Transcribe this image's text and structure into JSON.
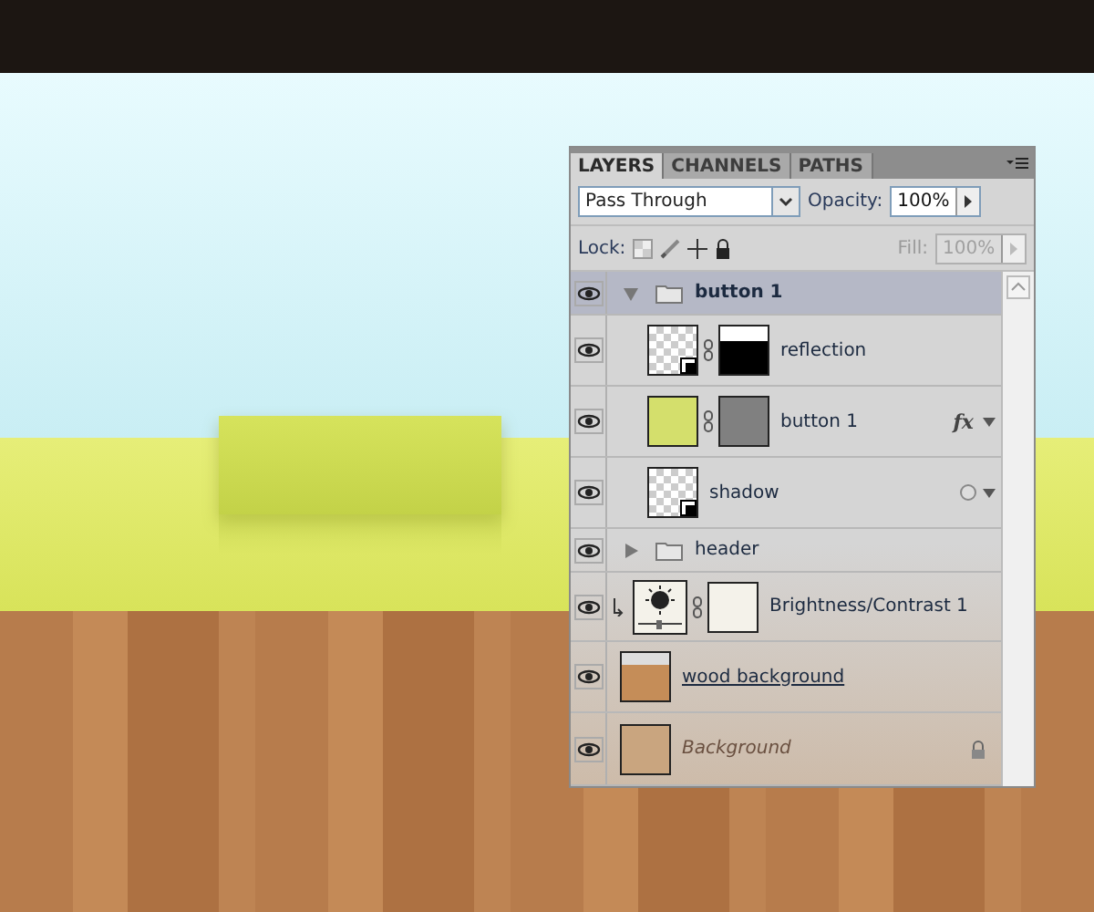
{
  "panel": {
    "tabs": [
      {
        "label": "LAYERS",
        "selected": true
      },
      {
        "label": "CHANNELS",
        "selected": false
      },
      {
        "label": "PATHS",
        "selected": false
      }
    ],
    "blend_mode": "Pass Through",
    "opacity_label": "Opacity:",
    "opacity": "100%",
    "lock_label": "Lock:",
    "fill_label": "Fill:",
    "fill": "100%",
    "fill_disabled": true,
    "layers": [
      {
        "kind": "group",
        "name": "button 1",
        "visible": true,
        "expanded": true,
        "selected": true,
        "children": [
          {
            "kind": "smart-object",
            "name": "reflection",
            "visible": true,
            "masked": true
          },
          {
            "kind": "shape",
            "name": "button 1",
            "visible": true,
            "effects_badge": "fx",
            "options": true
          },
          {
            "kind": "smart-object",
            "name": "shadow",
            "visible": true,
            "filter": true,
            "options": true
          }
        ]
      },
      {
        "kind": "group",
        "name": "header",
        "visible": true,
        "expanded": false,
        "selected": false
      },
      {
        "kind": "adjustment",
        "name": "Brightness/Contrast 1",
        "visible": true,
        "clipped": true
      },
      {
        "kind": "pixel",
        "name": "wood background",
        "visible": true,
        "underlined": true
      },
      {
        "kind": "background",
        "name": "Background",
        "visible": true,
        "locked": true
      }
    ]
  }
}
